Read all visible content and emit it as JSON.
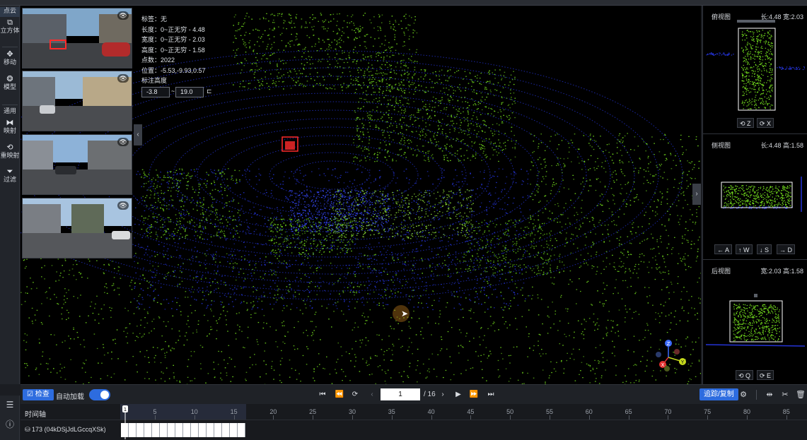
{
  "left_tools": [
    {
      "label": "点云",
      "icon": "",
      "active": true
    },
    {
      "label": "立方体",
      "icon": "cube-icon"
    },
    {
      "label": "移动",
      "icon": "move-icon"
    },
    {
      "label": "模型",
      "icon": "model-icon"
    },
    {
      "label": "通用",
      "icon": ""
    },
    {
      "label": "映射",
      "icon": "mirror-icon"
    },
    {
      "label": "重映射",
      "icon": "remap-icon"
    },
    {
      "label": "过滤",
      "icon": "filter-icon"
    }
  ],
  "info": {
    "label": "标签：无",
    "length": "长度：0~正无穷 - 4.48",
    "width": "宽度：0~正无穷 - 2.03",
    "height": "高度：0~正无穷 - 1.58",
    "points": "点数：2022",
    "position": "位置：-5.53,-9.93,0.57",
    "annot_height": "标注高度",
    "height_min": "-3.8",
    "height_tilde": "~",
    "height_max": "19.0"
  },
  "right_panel": {
    "top": {
      "title": "俯视图",
      "dims": "长:4.48 宽:2.03",
      "keys": [
        "Z",
        "X"
      ]
    },
    "side": {
      "title": "侧视图",
      "dims": "长:4.48 高:1.58",
      "keys": [
        "A",
        "W",
        "S",
        "D"
      ]
    },
    "back": {
      "title": "后视图",
      "dims": "宽:2.03 高:1.58",
      "keys": [
        "Q",
        "E"
      ]
    }
  },
  "bottom": {
    "check_label": "检查",
    "auto_load_label": "自动加载",
    "auto_load_on": true,
    "frame": "1",
    "total": "/ 16",
    "track_label": "追踪/复制"
  },
  "timeline": {
    "label": "时间轴",
    "ticks": [
      "5",
      "10",
      "15",
      "20",
      "25",
      "30",
      "35",
      "40",
      "45",
      "50",
      "55",
      "60",
      "65",
      "70",
      "75",
      "80",
      "85"
    ],
    "current": "1",
    "track_name": "173 (04kDSjJdLGccqXSk)",
    "frames_loaded": 16
  },
  "colors": {
    "accent": "#2d6cdf",
    "points_green": "#6fd41c",
    "points_blue": "#2433d6",
    "box_red": "#ff2a2a"
  }
}
